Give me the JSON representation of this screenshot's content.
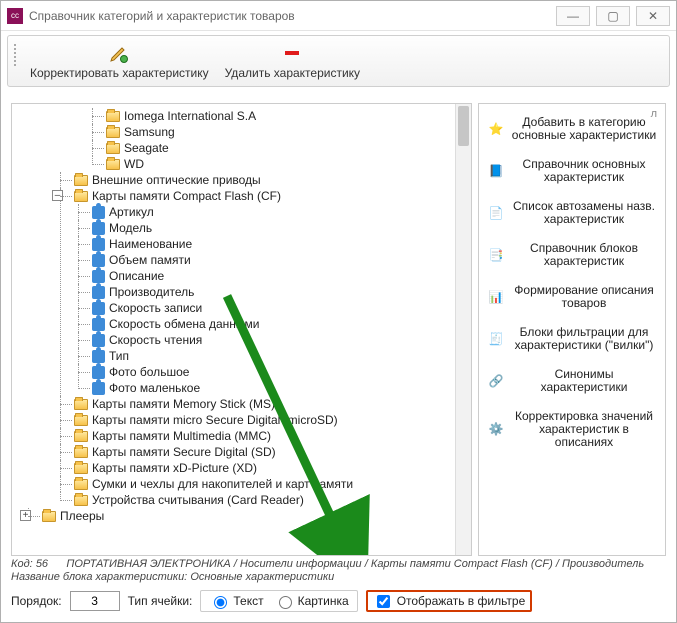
{
  "window": {
    "appicon_text": "cc",
    "title": "Справочник категорий и характеристик товаров"
  },
  "toolbar": {
    "edit": "Корректировать характеристику",
    "delete": "Удалить характеристику"
  },
  "tree": {
    "brands": [
      "Iomega International S.A",
      "Samsung",
      "Seagate",
      "WD"
    ],
    "node_optical": "Внешние оптические приводы",
    "node_cf": "Карты памяти Compact Flash (CF)",
    "cf_children": [
      "Артикул",
      "Модель",
      "Наименование",
      "Объем памяти",
      "Описание",
      "Производитель",
      "Скорость записи",
      "Скорость обмена данными",
      "Скорость чтения",
      "Тип",
      "Фото большое",
      "Фото маленькое"
    ],
    "siblings": [
      "Карты памяти Memory Stick (MS)",
      "Карты памяти micro Secure Digital (microSD)",
      "Карты памяти Multimedia (MMC)",
      "Карты памяти Secure Digital (SD)",
      "Карты памяти xD-Picture (XD)",
      "Сумки и чехлы для накопителей и карт памяти",
      "Устройства считывания (Card Reader)"
    ],
    "node_players": "Плееры"
  },
  "side": {
    "search_hint": "л",
    "items": [
      "Добавить в категорию основные характеристики",
      "Справочник основных характеристик",
      "Список автозамены назв. характеристик",
      "Справочник блоков характеристик",
      "Формирование описания товаров",
      "Блоки фильтрации для характеристики (\"вилки\")",
      "Синонимы характеристики",
      "Корректировка значений характеристик в описаниях"
    ]
  },
  "info": {
    "code_label": "Код:",
    "code_value": "56",
    "breadcrumb": "ПОРТАТИВНАЯ ЭЛЕКТРОНИКА / Носители информации / Карты памяти Compact Flash (CF) / Производитель",
    "block_label": "Название блока характеристики:",
    "block_value": "Основные характеристики"
  },
  "bottom": {
    "order_label": "Порядок:",
    "order_value": "3",
    "celltype_label": "Тип ячейки:",
    "opt_text": "Текст",
    "opt_image": "Картинка",
    "show_filter": "Отображать в фильтре"
  }
}
